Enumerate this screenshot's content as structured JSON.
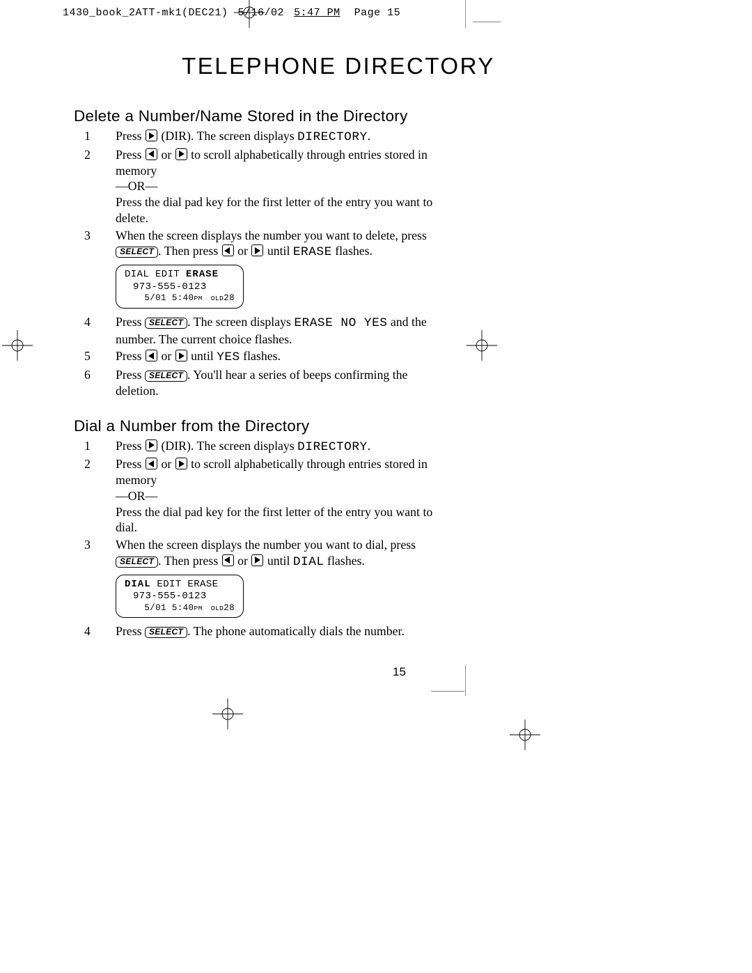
{
  "meta": {
    "header_file": "1430_book_2ATT-mk1(DEC21)",
    "header_date": "5/16/02",
    "header_time": "5:47 PM",
    "header_page": "Page 15"
  },
  "title": "TELEPHONE DIRECTORY",
  "labels": {
    "select": "SELECT",
    "directory_lcd": "DIRECTORY",
    "erase_lcd": "ERASE",
    "erase_no_yes": "ERASE  NO  YES",
    "yes_lcd": "YES",
    "dial_lcd": "DIAL",
    "or_sep": "—OR—"
  },
  "section1": {
    "heading": "Delete a Number/Name Stored in the Directory",
    "steps": {
      "s1a": "Press ",
      "s1b": " (DIR). The screen displays ",
      "s1c": ".",
      "s2a": "Press ",
      "s2b": " or ",
      "s2c": " to scroll alphabetically through entries stored in memory",
      "s2d": "Press the dial pad key for the first letter of the entry you want to delete.",
      "s3a": "When the screen displays the number you want to delete, press ",
      "s3b": ". Then press ",
      "s3c": " or ",
      "s3d": " until ",
      "s3e": " flashes.",
      "s4a": "Press ",
      "s4b": ". The screen displays ",
      "s4c": " and the number. The current choice flashes.",
      "s5a": "Press ",
      "s5b": " or ",
      "s5c": " until ",
      "s5d": " flashes.",
      "s6a": "Press ",
      "s6b": ". You'll hear a series of beeps confirming the deletion."
    },
    "lcd": {
      "row1a": "DIAL EDIT ",
      "row1b": "ERASE",
      "row2": "973-555-0123",
      "row3a": "5/01 5:40",
      "row3b": "PM  OLD",
      "row3c": "28"
    }
  },
  "section2": {
    "heading": "Dial a Number from the Directory",
    "steps": {
      "s1a": "Press ",
      "s1b": " (DIR). The screen displays ",
      "s1c": ".",
      "s2a": "Press ",
      "s2b": " or ",
      "s2c": " to scroll alphabetically through entries stored in memory",
      "s2d": "Press the dial pad key for the first letter of the entry you want to dial.",
      "s3a": "When the screen displays the number you want to dial, press ",
      "s3b": ". Then press ",
      "s3c": " or ",
      "s3d": " until ",
      "s3e": " flashes.",
      "s4a": "Press ",
      "s4b": ". The phone automatically dials the number."
    },
    "lcd": {
      "row1a": "DIAL",
      "row1b": " EDIT ERASE",
      "row2": "973-555-0123",
      "row3a": "5/01 5:40",
      "row3b": "PM  OLD",
      "row3c": "28"
    }
  },
  "page_number": "15"
}
